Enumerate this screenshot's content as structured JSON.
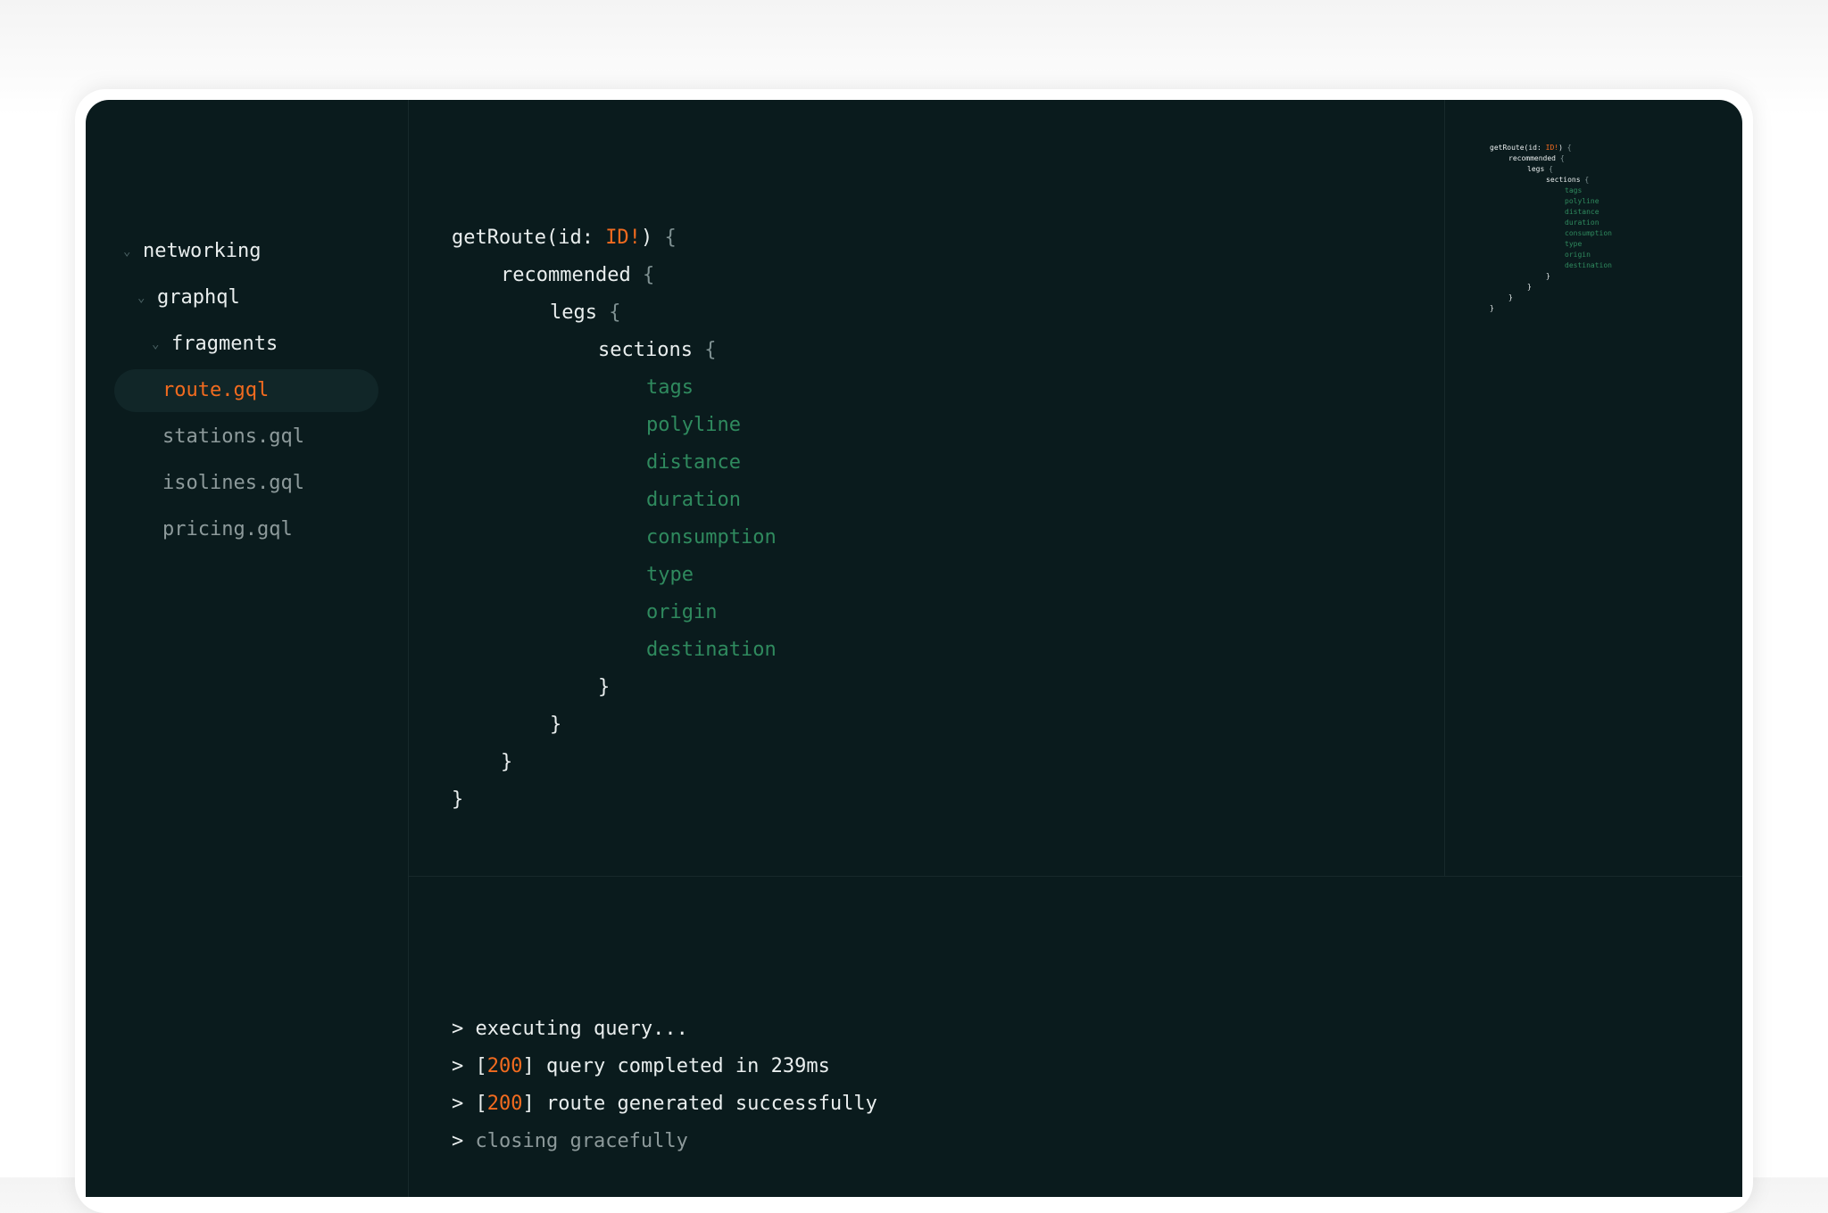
{
  "sidebar": {
    "folders": [
      {
        "label": "networking"
      },
      {
        "label": "graphql"
      },
      {
        "label": "fragments"
      }
    ],
    "files": [
      {
        "label": "route.gql",
        "active": true
      },
      {
        "label": "stations.gql",
        "active": false
      },
      {
        "label": "isolines.gql",
        "active": false
      },
      {
        "label": "pricing.gql",
        "active": false
      }
    ]
  },
  "editor": {
    "query_name": "getRoute(id: ",
    "arg_type": "ID!",
    "query_close": ")",
    "open_brace": "{",
    "close_brace": "}",
    "blocks": [
      "recommended",
      "legs",
      "sections"
    ],
    "fields": [
      "tags",
      "polyline",
      "distance",
      "duration",
      "consumption",
      "type",
      "origin",
      "destination"
    ]
  },
  "console": {
    "prompt": ">",
    "lines": [
      {
        "text": "executing query..."
      },
      {
        "open": "[",
        "code": "200",
        "close": "]",
        "text": "query completed in 239ms"
      },
      {
        "open": "[",
        "code": "200",
        "close": "]",
        "text": "route generated successfully"
      },
      {
        "text": "closing gracefully"
      }
    ]
  },
  "colors": {
    "background": "#0a1b1d",
    "accent": "#f26b1f",
    "field": "#2f8a5e",
    "text": "#e9eeee",
    "muted": "#8d9a9b"
  },
  "icons": {
    "folder_chevron": "chevron-down-icon"
  }
}
